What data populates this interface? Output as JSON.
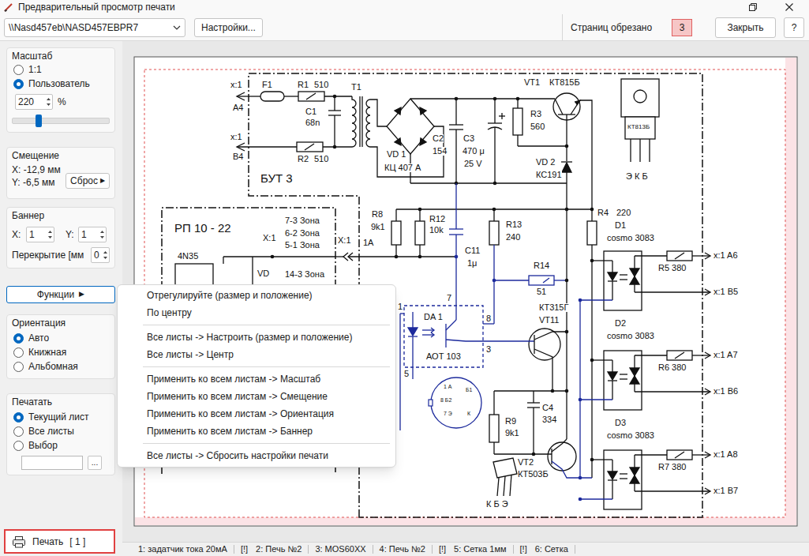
{
  "window": {
    "title": "Предварительный просмотр печати"
  },
  "toolbar": {
    "printer": "\\\\Nasd457eb\\NASD457EBPR7",
    "settings_button": "Настройки...",
    "cut_pages_label": "Страниц обрезано",
    "cut_pages_count": "3",
    "close_button": "Закрыть",
    "help_button": "?"
  },
  "scale": {
    "title": "Масштаб",
    "options": [
      {
        "label": "1:1",
        "selected": false
      },
      {
        "label": "Пользователь",
        "selected": true
      }
    ],
    "value": "220",
    "unit": "%",
    "level": 0.27
  },
  "offset": {
    "title": "Смещение",
    "x": "X: -12,9 мм",
    "y": "Y: -6,5 мм",
    "reset_button": "Сброс",
    "reset_arrow": "▶"
  },
  "banner": {
    "title": "Баннер",
    "x_label": "X:",
    "x_value": "1",
    "y_label": "Y:",
    "y_value": "1",
    "overlap_label": "Перекрытие [мм",
    "overlap_value": "0"
  },
  "functions_button": {
    "label": "Функции",
    "arrow": "▶",
    "expanded": true
  },
  "orientation": {
    "title": "Ориентация",
    "options": [
      {
        "label": "Авто",
        "selected": true
      },
      {
        "label": "Книжная",
        "selected": false
      },
      {
        "label": "Альбомная",
        "selected": false
      }
    ]
  },
  "print_range": {
    "title": "Печатать",
    "options": [
      {
        "label": "Текущий лист",
        "selected": true
      },
      {
        "label": "Все листы",
        "selected": false
      },
      {
        "label": "Выбор",
        "selected": false
      }
    ],
    "selection_value": "",
    "browse_button": "..."
  },
  "print_button": {
    "label": "Печать",
    "count": "[ 1 ]"
  },
  "menu": {
    "items": [
      {
        "kind": "item",
        "label": "Отрегулируйте (размер и положение)"
      },
      {
        "kind": "item",
        "label": "По центру"
      },
      {
        "kind": "separator"
      },
      {
        "kind": "item",
        "label": "Все листы -> Настроить (размер и положение)"
      },
      {
        "kind": "item",
        "label": "Все листы -> Центр"
      },
      {
        "kind": "separator"
      },
      {
        "kind": "item",
        "label": "Применить ко всем листам -> Масштаб"
      },
      {
        "kind": "item",
        "label": "Применить ко всем листам -> Смещение"
      },
      {
        "kind": "item",
        "label": "Применить ко всем листам -> Ориентация"
      },
      {
        "kind": "item",
        "label": "Применить ко всем листам -> Баннер"
      },
      {
        "kind": "separator"
      },
      {
        "kind": "item",
        "label": "Все листы -> Сбросить настройки печати"
      }
    ]
  },
  "schematic": {
    "labels": [
      "x:1",
      "A4",
      "x:1",
      "B4",
      "F1",
      "R1",
      "510",
      "T1",
      "C1",
      "68n",
      "R2",
      "510",
      "VD 1",
      "КЦ 407 А",
      "C2",
      "154",
      "C3",
      "470 μ",
      "25 V",
      "R3",
      "560",
      "VT1",
      "КТ815Б",
      "VD 2",
      "КС191",
      "БУТ 3",
      "КТ813Б",
      "Э К Б",
      "R4",
      "220",
      "D1",
      "cosmo 3083",
      "РП 10 - 22",
      "X:1",
      "7-3 Зона",
      "6-2 Зона",
      "5-1 Зона",
      "14-3 Зона",
      "X:1",
      "1А",
      "R8",
      "9k1",
      "R12",
      "10k",
      "R13",
      "240",
      "C11",
      "1μ",
      "4N35",
      "VD",
      "R14",
      "51",
      "7",
      "1",
      "DA 1",
      "8",
      "3",
      "АОТ 103",
      "5",
      "КТ315Г",
      "VT11",
      "x:1 A6",
      "R5 380",
      "x:1 B5",
      "D2",
      "cosmo 3083",
      "x:1 A7",
      "R6 380",
      "x:1 B6",
      "D3",
      "cosmo 3083",
      "x:1 A8",
      "R7 380",
      "x:1 B7",
      "C4",
      "334",
      "R9",
      "9k1",
      "VT2",
      "КТ503Б",
      "К Б Э",
      "1 А",
      "Б1",
      "8 Б2",
      "7 Э",
      "К"
    ]
  },
  "status_bar": {
    "tabs": [
      {
        "label": "1: задатчик тока 20мА"
      },
      {
        "prefix": "[!]",
        "label": "2: Печь №2"
      },
      {
        "label": "3: MOS60XX"
      },
      {
        "label": "4: Печь №2"
      },
      {
        "prefix": "[!]",
        "label": "5: Сетка 1мм"
      },
      {
        "prefix": "[!]",
        "label": "6: Сетка"
      }
    ]
  }
}
